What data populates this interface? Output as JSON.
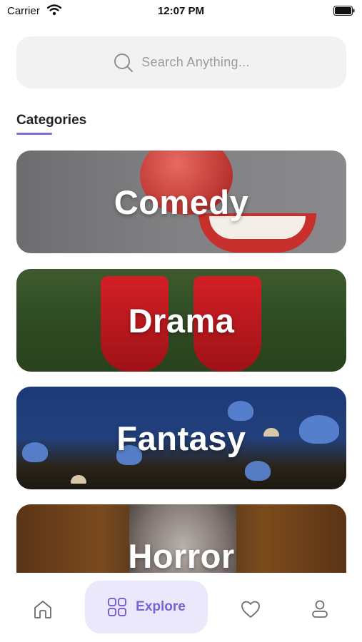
{
  "status_bar": {
    "carrier": "Carrier",
    "time": "12:07 PM"
  },
  "search": {
    "placeholder": "Search Anything..."
  },
  "section": {
    "title": "Categories"
  },
  "categories": [
    {
      "label": "Comedy"
    },
    {
      "label": "Drama"
    },
    {
      "label": "Fantasy"
    },
    {
      "label": "Horror"
    }
  ],
  "tab_bar": {
    "items": [
      {
        "icon": "home-icon",
        "label": ""
      },
      {
        "icon": "grid-icon",
        "label": "Explore",
        "active": true
      },
      {
        "icon": "heart-icon",
        "label": ""
      },
      {
        "icon": "user-icon",
        "label": ""
      }
    ],
    "accent": "#7a62d6",
    "active_bg": "#ebe8fb"
  }
}
